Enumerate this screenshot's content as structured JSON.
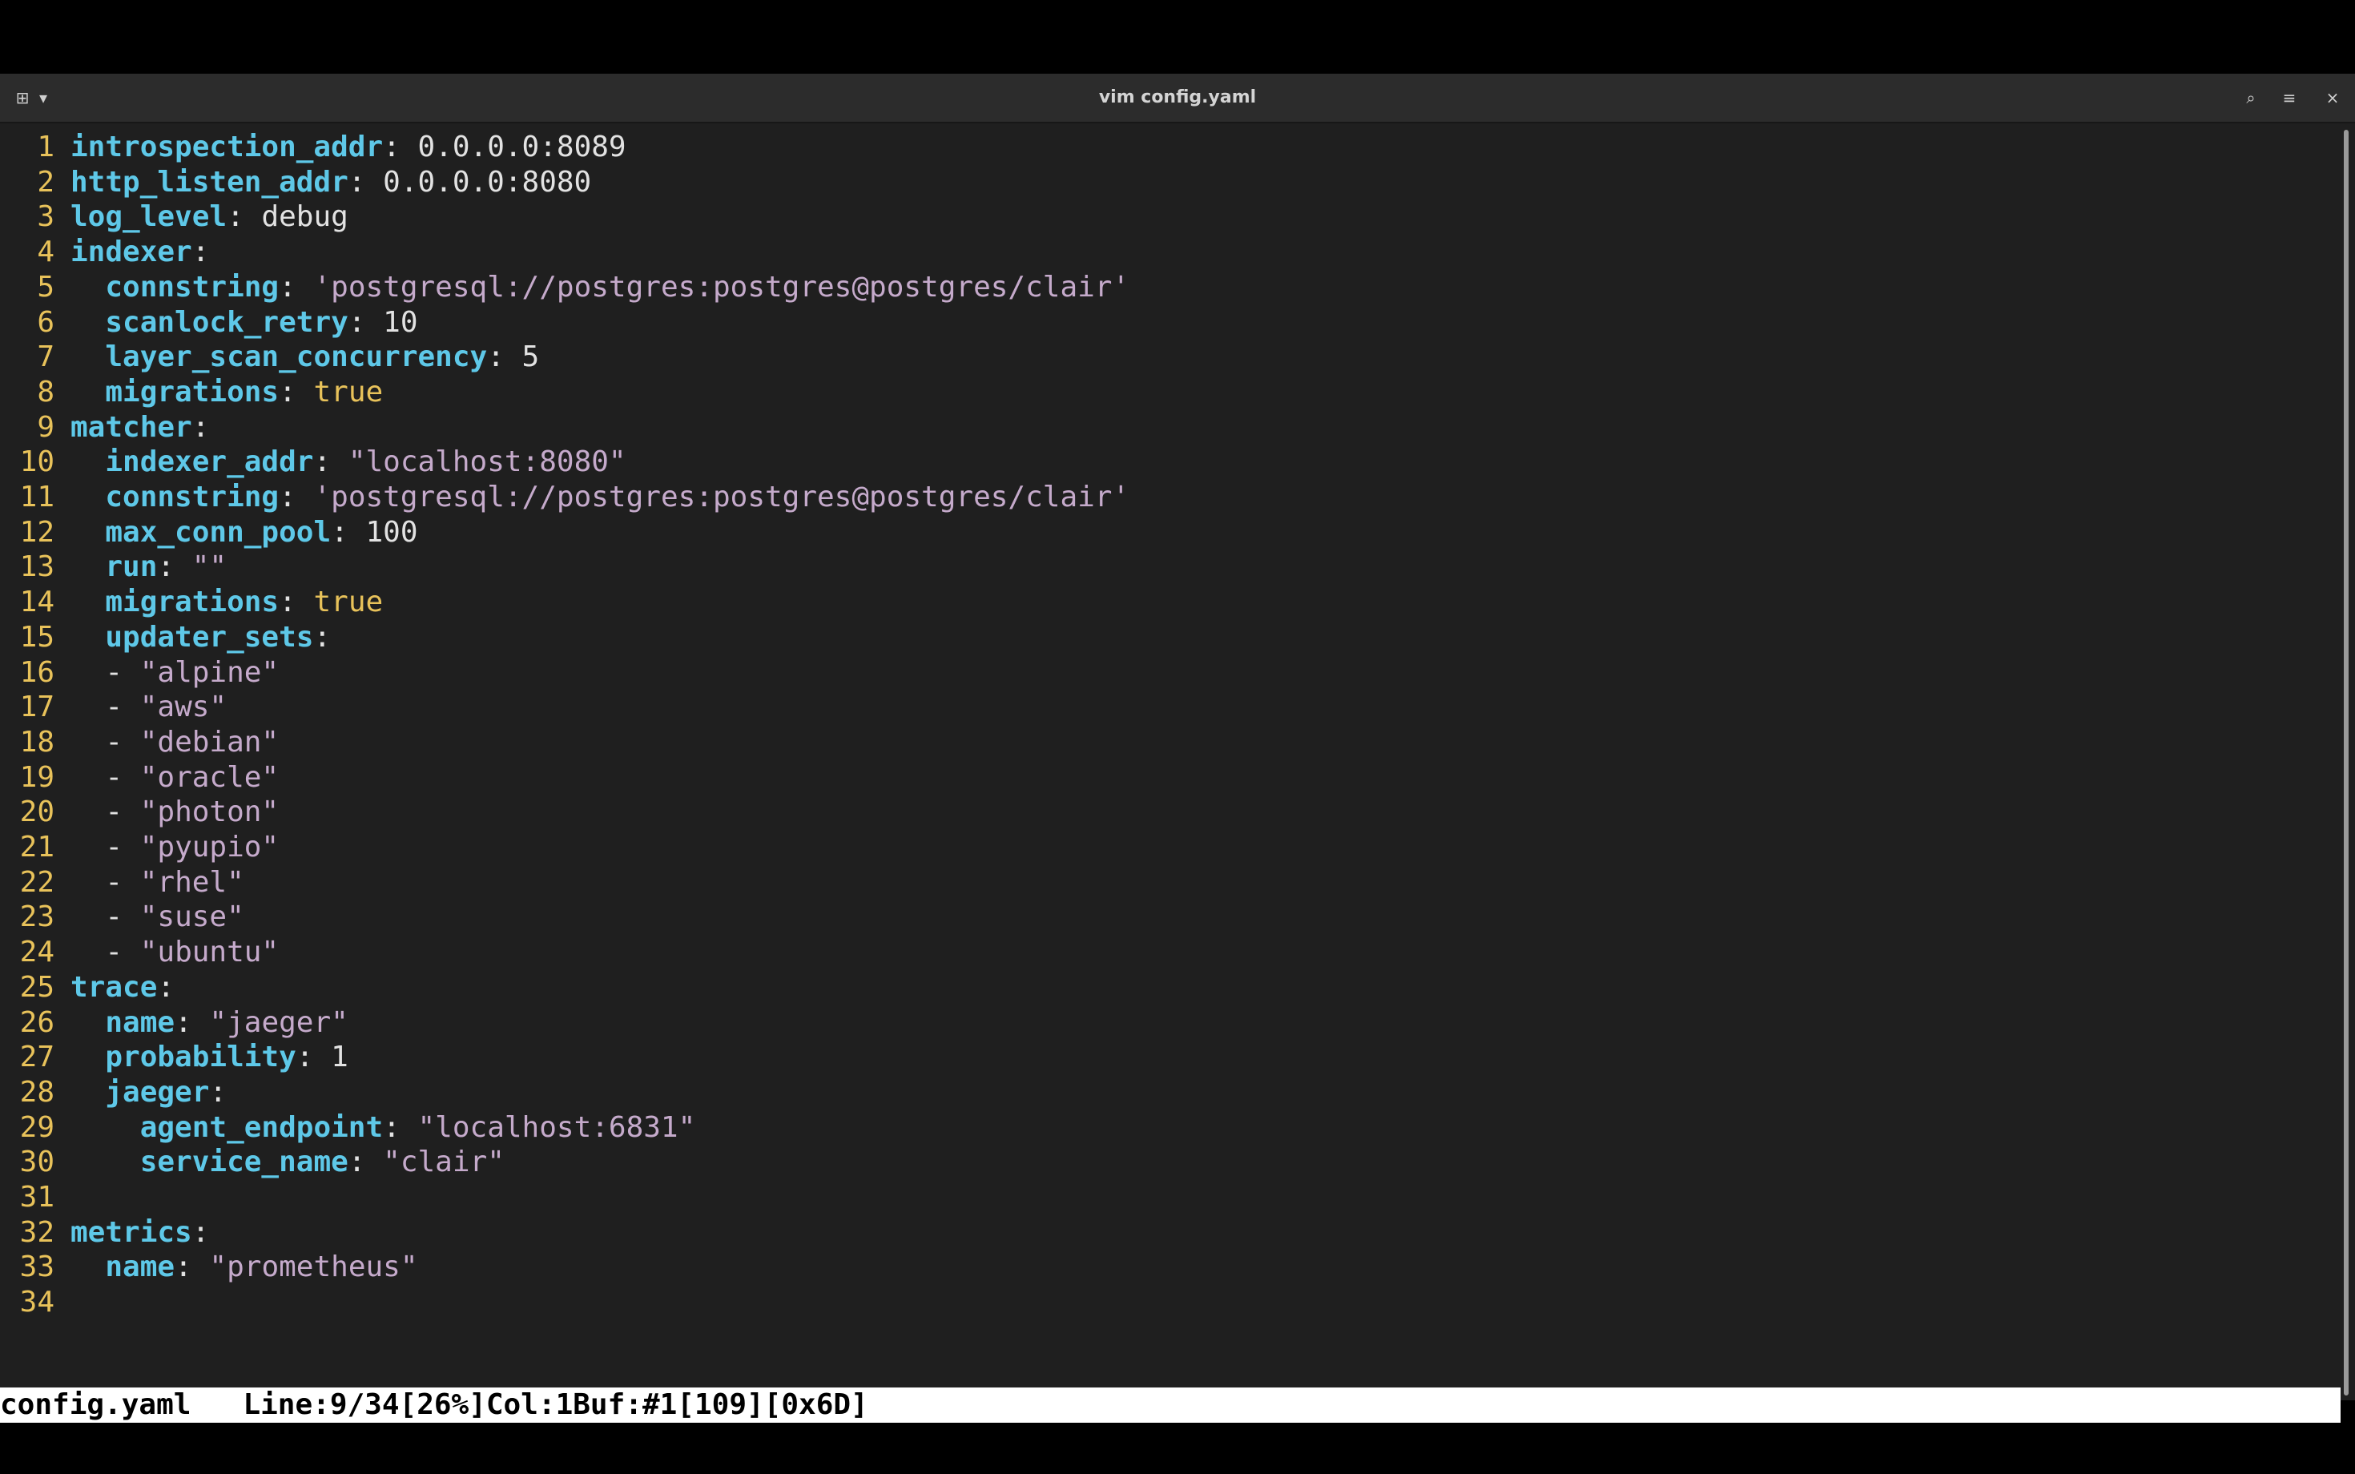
{
  "window": {
    "title": "vim config.yaml",
    "buttons": {
      "new_tab_icon": "⊞",
      "dropdown_icon": "▾",
      "search_icon": "⌕",
      "menu_icon": "≡",
      "close_icon": "×"
    }
  },
  "colors": {
    "key": "#5ec8e8",
    "string": "#c5aacb",
    "boolean": "#e8c25a",
    "line_number": "#e8c25a",
    "background": "#1f1f1f"
  },
  "lines": [
    {
      "n": "1",
      "indent": "",
      "key": "introspection_addr",
      "sep": ": ",
      "value": "0.0.0.0:8089",
      "type": "n"
    },
    {
      "n": "2",
      "indent": "",
      "key": "http_listen_addr",
      "sep": ": ",
      "value": "0.0.0.0:8080",
      "type": "n"
    },
    {
      "n": "3",
      "indent": "",
      "key": "log_level",
      "sep": ": ",
      "value": "debug",
      "type": "n"
    },
    {
      "n": "4",
      "indent": "",
      "key": "indexer",
      "sep": ":",
      "value": "",
      "type": "n"
    },
    {
      "n": "5",
      "indent": "  ",
      "key": "connstring",
      "sep": ": ",
      "value": "'postgresql://postgres:postgres@postgres/clair'",
      "type": "s"
    },
    {
      "n": "6",
      "indent": "  ",
      "key": "scanlock_retry",
      "sep": ": ",
      "value": "10",
      "type": "n"
    },
    {
      "n": "7",
      "indent": "  ",
      "key": "layer_scan_concurrency",
      "sep": ": ",
      "value": "5",
      "type": "n"
    },
    {
      "n": "8",
      "indent": "  ",
      "key": "migrations",
      "sep": ": ",
      "value": "true",
      "type": "b"
    },
    {
      "n": "9",
      "indent": "",
      "key": "matcher",
      "sep": ":",
      "value": "",
      "type": "n"
    },
    {
      "n": "10",
      "indent": "  ",
      "key": "indexer_addr",
      "sep": ": ",
      "value": "\"localhost:8080\"",
      "type": "s"
    },
    {
      "n": "11",
      "indent": "  ",
      "key": "connstring",
      "sep": ": ",
      "value": "'postgresql://postgres:postgres@postgres/clair'",
      "type": "s"
    },
    {
      "n": "12",
      "indent": "  ",
      "key": "max_conn_pool",
      "sep": ": ",
      "value": "100",
      "type": "n"
    },
    {
      "n": "13",
      "indent": "  ",
      "key": "run",
      "sep": ": ",
      "value": "\"\"",
      "type": "s"
    },
    {
      "n": "14",
      "indent": "  ",
      "key": "migrations",
      "sep": ": ",
      "value": "true",
      "type": "b"
    },
    {
      "n": "15",
      "indent": "  ",
      "key": "updater_sets",
      "sep": ":",
      "value": "",
      "type": "n"
    },
    {
      "n": "16",
      "indent": "  ",
      "key": "",
      "sep": "- ",
      "value": "\"alpine\"",
      "type": "s"
    },
    {
      "n": "17",
      "indent": "  ",
      "key": "",
      "sep": "- ",
      "value": "\"aws\"",
      "type": "s"
    },
    {
      "n": "18",
      "indent": "  ",
      "key": "",
      "sep": "- ",
      "value": "\"debian\"",
      "type": "s"
    },
    {
      "n": "19",
      "indent": "  ",
      "key": "",
      "sep": "- ",
      "value": "\"oracle\"",
      "type": "s"
    },
    {
      "n": "20",
      "indent": "  ",
      "key": "",
      "sep": "- ",
      "value": "\"photon\"",
      "type": "s"
    },
    {
      "n": "21",
      "indent": "  ",
      "key": "",
      "sep": "- ",
      "value": "\"pyupio\"",
      "type": "s"
    },
    {
      "n": "22",
      "indent": "  ",
      "key": "",
      "sep": "- ",
      "value": "\"rhel\"",
      "type": "s"
    },
    {
      "n": "23",
      "indent": "  ",
      "key": "",
      "sep": "- ",
      "value": "\"suse\"",
      "type": "s"
    },
    {
      "n": "24",
      "indent": "  ",
      "key": "",
      "sep": "- ",
      "value": "\"ubuntu\"",
      "type": "s"
    },
    {
      "n": "25",
      "indent": "",
      "key": "trace",
      "sep": ":",
      "value": "",
      "type": "n"
    },
    {
      "n": "26",
      "indent": "  ",
      "key": "name",
      "sep": ": ",
      "value": "\"jaeger\"",
      "type": "s"
    },
    {
      "n": "27",
      "indent": "  ",
      "key": "probability",
      "sep": ": ",
      "value": "1",
      "type": "n"
    },
    {
      "n": "28",
      "indent": "  ",
      "key": "jaeger",
      "sep": ":",
      "value": "",
      "type": "n"
    },
    {
      "n": "29",
      "indent": "    ",
      "key": "agent_endpoint",
      "sep": ": ",
      "value": "\"localhost:6831\"",
      "type": "s"
    },
    {
      "n": "30",
      "indent": "    ",
      "key": "service_name",
      "sep": ": ",
      "value": "\"clair\"",
      "type": "s"
    },
    {
      "n": "31",
      "indent": "",
      "key": "",
      "sep": "",
      "value": "",
      "type": "n"
    },
    {
      "n": "32",
      "indent": "",
      "key": "metrics",
      "sep": ":",
      "value": "",
      "type": "n"
    },
    {
      "n": "33",
      "indent": "  ",
      "key": "name",
      "sep": ": ",
      "value": "\"prometheus\"",
      "type": "s"
    },
    {
      "n": "34",
      "indent": "",
      "key": "",
      "sep": "",
      "value": "",
      "type": "n"
    }
  ],
  "status": {
    "filename": "config.yaml",
    "position": "Line:9/34[26%]Col:1Buf:#1[109][0x6D]"
  }
}
